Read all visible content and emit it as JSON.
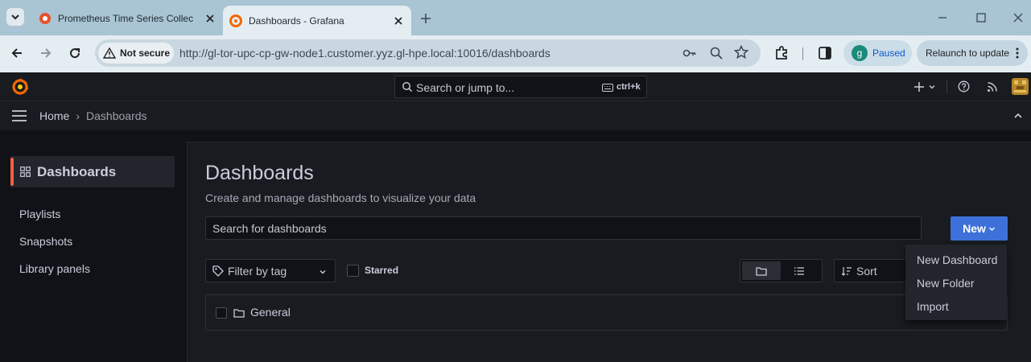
{
  "browser": {
    "tabs": [
      {
        "title": "Prometheus Time Series Collect",
        "active": false
      },
      {
        "title": "Dashboards - Grafana",
        "active": true
      }
    ],
    "security_label": "Not secure",
    "url": "http://gl-tor-upc-cp-gw-node1.customer.yyz.gl-hpe.local:10016/dashboards",
    "profile_initial": "g",
    "profile_status": "Paused",
    "relaunch_label": "Relaunch to update"
  },
  "topbar": {
    "search_placeholder": "Search or jump to...",
    "shortcut": "ctrl+k"
  },
  "breadcrumb": {
    "home": "Home",
    "separator": "›",
    "current": "Dashboards"
  },
  "sidebar": {
    "title": "Dashboards",
    "items": [
      {
        "label": "Playlists"
      },
      {
        "label": "Snapshots"
      },
      {
        "label": "Library panels"
      }
    ]
  },
  "page": {
    "title": "Dashboards",
    "subtitle": "Create and manage dashboards to visualize your data",
    "search_placeholder": "Search for dashboards",
    "new_button": "New",
    "filter_tag_placeholder": "Filter by tag",
    "starred_label": "Starred",
    "sort_label": "Sort",
    "folders": [
      {
        "name": "General"
      }
    ]
  },
  "new_menu": {
    "items": [
      {
        "label": "New Dashboard"
      },
      {
        "label": "New Folder"
      },
      {
        "label": "Import"
      }
    ]
  },
  "colors": {
    "accent": "#3d71d9",
    "active_bar": "#f55f3e",
    "text": "#ccccdc"
  }
}
